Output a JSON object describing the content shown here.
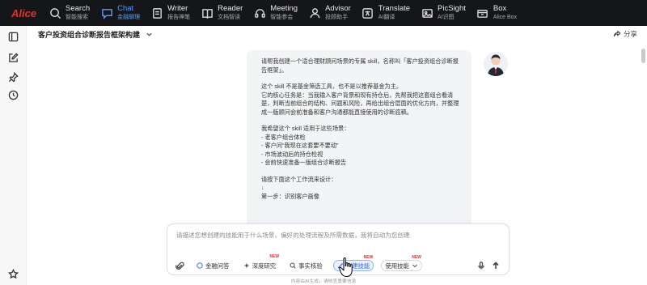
{
  "brand": {
    "name": "Alice",
    "color": "#e5312b"
  },
  "nav": [
    {
      "title": "Search",
      "sub": "智能搜索",
      "icon": "search-icon",
      "active": false
    },
    {
      "title": "Chat",
      "sub": "金融聊理",
      "icon": "chat-icon",
      "active": true
    },
    {
      "title": "Writer",
      "sub": "报告神笔",
      "icon": "pen-icon",
      "active": false
    },
    {
      "title": "Reader",
      "sub": "文档智读",
      "icon": "book-icon",
      "active": false
    },
    {
      "title": "Meeting",
      "sub": "智能参会",
      "icon": "headset-icon",
      "active": false
    },
    {
      "title": "Advisor",
      "sub": "投顾助手",
      "icon": "person-icon",
      "active": false
    },
    {
      "title": "Translate",
      "sub": "AI翻译",
      "icon": "translate-icon",
      "active": false
    },
    {
      "title": "PicSight",
      "sub": "AI识图",
      "icon": "image-icon",
      "active": false
    },
    {
      "title": "Box",
      "sub": "Alice Box",
      "icon": "box-icon",
      "active": false
    }
  ],
  "header": {
    "title": "客户投资组合诊断报告框架构建",
    "share_label": "分享"
  },
  "message": {
    "lines": [
      "请帮我创建一个适合理财顾问场景的专属 skill，名称叫「客户投资组合诊断报",
      "告框架」。",
      "",
      "这个 skill 不是基金筛选工具，也不是以推荐基金为主。",
      "它的核心任务是：当我输入客户背景和现有持仓后，先帮我把这套组合看清",
      "楚，判断当前组合的结构、问题和风险，再给出组合层面的优化方向，并整理",
      "成一版顾问会前准备和客户沟通都能直接使用的诊断底稿。",
      "",
      "我希望这个 skill 适用于这些场景：",
      "- 老客户组合体检",
      "- 客户问“我现在这套要不要动”",
      "- 市场波动后的持仓检视",
      "- 会前快速准备一版组合诊断报告",
      "",
      "请按下面这个工作流来设计：",
      "",
      "第一步：识别客户画像"
    ]
  },
  "composer": {
    "placeholder": "请描述您想创建的技能用于什么场景、偏好的处理流程及所需数据，我将自动为您创建",
    "chips": [
      {
        "label": "金融问答",
        "badge": "",
        "selected": false,
        "icon": "chat-bubble-icon"
      },
      {
        "label": "深度研究",
        "badge": "NEW",
        "selected": false,
        "icon": "sparkle-icon"
      },
      {
        "label": "事实核验",
        "badge": "",
        "selected": false,
        "icon": "check-search-icon"
      },
      {
        "label": "创建技能",
        "badge": "NEW",
        "selected": true,
        "icon": "wand-icon"
      },
      {
        "label": "使用技能",
        "badge": "NEW",
        "selected": false,
        "icon": ""
      }
    ]
  },
  "footer_note": "内容由AI生成，请核查重要信息",
  "colors": {
    "accent": "#2f6ad9",
    "topbar": "#15161a",
    "active_nav": "#5d9bff"
  }
}
